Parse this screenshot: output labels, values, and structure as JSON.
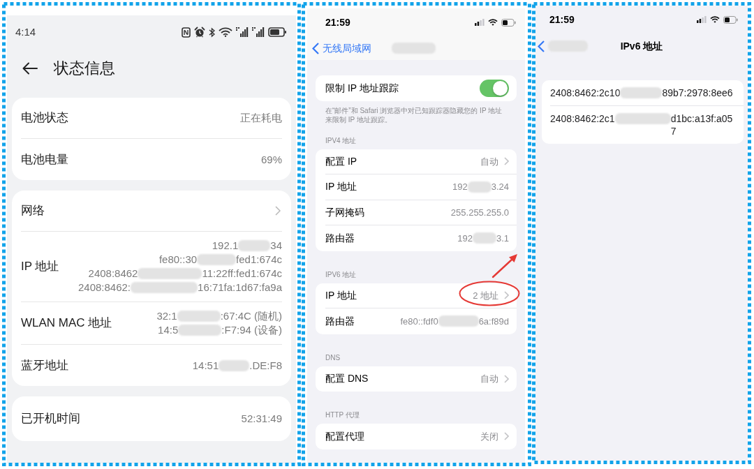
{
  "status_screen": {
    "status_bar": {
      "time": "4:14"
    },
    "title": "状态信息",
    "cards": [
      {
        "rows": [
          {
            "label": "电池状态",
            "values": [
              [
                "正在耗电"
              ]
            ],
            "chevron": false
          },
          {
            "label": "电池电量",
            "values": [
              [
                "69%"
              ]
            ],
            "chevron": false
          }
        ]
      },
      {
        "rows": [
          {
            "label": "网络",
            "chevron": true
          },
          {
            "label": "IP 地址",
            "values": [
              [
                "192.1",
                "34"
              ],
              [
                "fe80::30",
                "fed1:674c"
              ],
              [
                "2408:8462",
                "11:22ff:fed1:674c"
              ],
              [
                "2408:8462:",
                "16:71fa:1d67:fa9a"
              ]
            ],
            "chevron": false
          },
          {
            "label": "WLAN MAC 地址",
            "values": [
              [
                "32:1",
                ":67:4C (随机)"
              ],
              [
                "14:5",
                ":F7:94 (设备)"
              ]
            ],
            "chevron": false
          },
          {
            "label": "蓝牙地址",
            "values": [
              [
                "14:51",
                ".DE:F8"
              ]
            ],
            "chevron": false
          }
        ]
      },
      {
        "rows": [
          {
            "label": "已开机时间",
            "values": [
              [
                "52:31:49"
              ]
            ],
            "chevron": false
          }
        ]
      }
    ]
  },
  "wlan_screen": {
    "status_bar": {
      "time": "21:59"
    },
    "back_label": "无线局域网",
    "groups": [
      {
        "rows": [
          {
            "kind": "toggle",
            "label": "限制 IP 地址跟踪",
            "on": true
          }
        ],
        "footer": "在“邮件”和 Safari 浏览器中对已知跟踪器隐藏您的 IP 地址来限制 IP 地址跟踪。"
      },
      {
        "header": "IPV4 地址",
        "rows": [
          {
            "kind": "value",
            "label": "配置 IP",
            "value": [
              "自动"
            ],
            "chevron": true
          },
          {
            "kind": "value",
            "label": "IP 地址",
            "value": [
              "192",
              "3.24"
            ],
            "chevron": false
          },
          {
            "kind": "value",
            "label": "子网掩码",
            "value": [
              "255.255.255.0"
            ],
            "chevron": false
          },
          {
            "kind": "value",
            "label": "路由器",
            "value": [
              "192",
              "3.1"
            ],
            "chevron": false
          }
        ]
      },
      {
        "header": "IPV6 地址",
        "rows": [
          {
            "kind": "value",
            "label": "IP 地址",
            "value": [
              "2 地址"
            ],
            "chevron": true
          },
          {
            "kind": "value",
            "label": "路由器",
            "value": [
              "fe80::fdf0",
              "6a:f89d"
            ],
            "chevron": false
          }
        ]
      },
      {
        "header": "DNS",
        "rows": [
          {
            "kind": "value",
            "label": "配置 DNS",
            "value": [
              "自动"
            ],
            "chevron": true
          }
        ]
      },
      {
        "header": "HTTP 代理",
        "rows": [
          {
            "kind": "value",
            "label": "配置代理",
            "value": [
              "关闭"
            ],
            "chevron": true
          }
        ]
      }
    ]
  },
  "ipv6_screen": {
    "status_bar": {
      "time": "21:59"
    },
    "title": "IPv6 地址",
    "addresses": [
      [
        "2408:8462:2c10",
        "89b7:2978:8ee6"
      ],
      [
        "2408:8462:2c1",
        "d1bc:a13f:a057"
      ]
    ]
  }
}
